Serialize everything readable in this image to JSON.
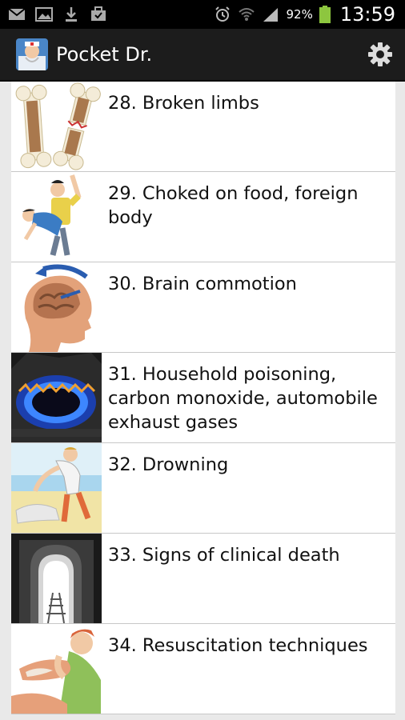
{
  "status_bar": {
    "battery": "92%",
    "time": "13:59",
    "left_icons": [
      "mail-icon",
      "image-icon",
      "download-icon",
      "briefcase-icon"
    ],
    "right_icons": [
      "alarm-icon",
      "wifi-icon",
      "signal-icon",
      "battery-icon"
    ]
  },
  "app_bar": {
    "title": "Pocket Dr.",
    "logo_icon": "doctor-logo-icon",
    "settings_icon": "gear-icon"
  },
  "items": [
    {
      "label": "28. Broken limbs",
      "thumb": "broken-bone-icon"
    },
    {
      "label": "29. Choked on food, foreign body",
      "thumb": "choking-icon"
    },
    {
      "label": "30. Brain commotion",
      "thumb": "brain-icon"
    },
    {
      "label": "31. Household poisoning, carbon monoxide, automobile exhaust gases",
      "thumb": "gas-flame-icon"
    },
    {
      "label": "32. Drowning",
      "thumb": "drowning-icon"
    },
    {
      "label": "33. Signs of clinical death",
      "thumb": "tunnel-icon"
    },
    {
      "label": "34. Resuscitation techniques",
      "thumb": "resuscitation-icon"
    }
  ]
}
